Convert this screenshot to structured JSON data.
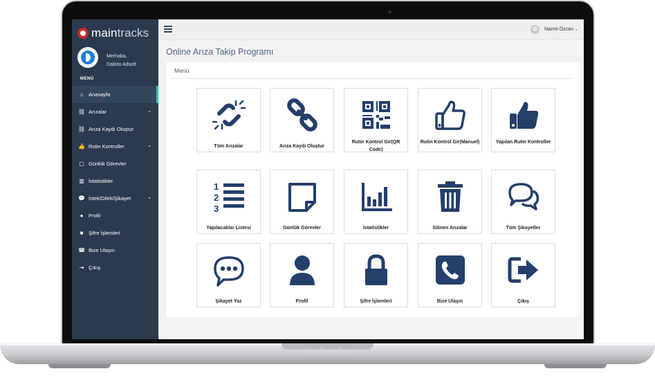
{
  "device": {
    "brand": "MacBook Pro"
  },
  "app": {
    "logo_main": "main",
    "logo_tracks": "tracks",
    "greeting": "Merhaba,",
    "user_company": "Dalisto Adsoft",
    "menu_heading": "MENÜ",
    "top_user": "Nazmi Özcan"
  },
  "sidebar": {
    "items": [
      {
        "label": "Anasayfa",
        "icon": "home-icon",
        "active": true
      },
      {
        "label": "Arızalar",
        "icon": "link-icon",
        "has_sub": true
      },
      {
        "label": "Arıza Kaydı Oluştur",
        "icon": "link-icon"
      },
      {
        "label": "Rutin Kontroller",
        "icon": "thumbs-up-icon",
        "has_sub": true
      },
      {
        "label": "Günlük Görevler",
        "icon": "note-icon"
      },
      {
        "label": "İstatistikler",
        "icon": "bar-chart-icon"
      },
      {
        "label": "İstek/Dilek/Şikayet",
        "icon": "comments-icon",
        "has_sub": true
      },
      {
        "label": "Profil",
        "icon": "user-icon"
      },
      {
        "label": "Şifre İşlemleri",
        "icon": "lock-icon"
      },
      {
        "label": "Bize Ulaşın",
        "icon": "phone-icon"
      },
      {
        "label": "Çıkış",
        "icon": "sign-out-icon"
      }
    ]
  },
  "page": {
    "title": "Online Arıza Takip Programı",
    "panel_title": "Menü"
  },
  "tiles": [
    {
      "label": "Tüm Arızalar",
      "icon": "broken-link-icon"
    },
    {
      "label": "Arıza Kaydı Oluştur",
      "icon": "link-icon"
    },
    {
      "label": "Rutin Kontrol Gir(QR Code)",
      "icon": "qr-code-icon"
    },
    {
      "label": "Rutin Kontrol Gir(Manuel)",
      "icon": "thumbs-up-outline-icon"
    },
    {
      "label": "Yapılan Rutin Kontroller",
      "icon": "thumbs-up-icon"
    },
    {
      "label": "Yapılacaklar Listesi",
      "icon": "ordered-list-icon"
    },
    {
      "label": "Günlük Görevler",
      "icon": "sticky-note-icon"
    },
    {
      "label": "İstatistikler",
      "icon": "bar-chart-icon"
    },
    {
      "label": "Silinen Arızalar",
      "icon": "trash-icon"
    },
    {
      "label": "Tüm Şikayetler",
      "icon": "comments-icon"
    },
    {
      "label": "Şikayet Yaz",
      "icon": "comment-dots-icon"
    },
    {
      "label": "Profil",
      "icon": "user-icon"
    },
    {
      "label": "Şifre İşlemleri",
      "icon": "lock-icon"
    },
    {
      "label": "Bize Ulaşın",
      "icon": "phone-square-icon"
    },
    {
      "label": "Çıkış",
      "icon": "sign-out-icon"
    }
  ],
  "colors": {
    "icon": "#243f6b",
    "sidebar": "#2b3a4e",
    "accent": "#33c3a8"
  }
}
